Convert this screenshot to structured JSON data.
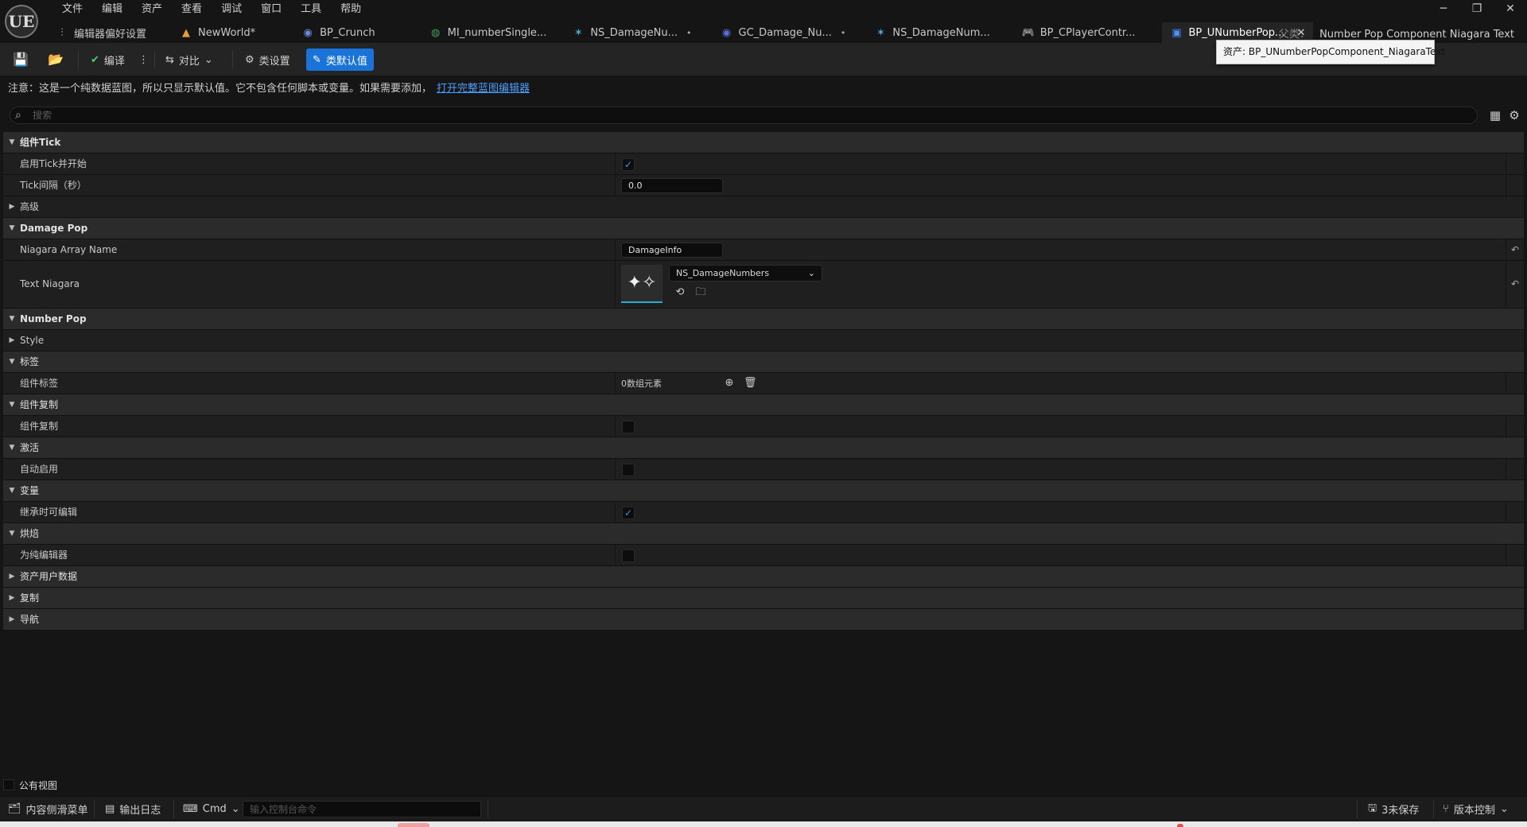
{
  "app": {
    "logo": "UE"
  },
  "menu": [
    "文件",
    "编辑",
    "资产",
    "查看",
    "调试",
    "窗口",
    "工具",
    "帮助"
  ],
  "window_controls": {
    "minimize": "─",
    "restore": "❐",
    "close": "✕"
  },
  "tabs": [
    {
      "label": "编辑器偏好设置",
      "icon": "sliders-icon",
      "glyph": "⫶",
      "dirty": false,
      "active": false
    },
    {
      "label": "NewWorld*",
      "icon": "level-icon",
      "glyph": "▲",
      "dirty": false,
      "active": false
    },
    {
      "label": "BP_Crunch",
      "icon": "character-icon",
      "glyph": "👤",
      "dirty": false,
      "active": false
    },
    {
      "label": "MI_numberSingle...",
      "icon": "material-instance-icon",
      "glyph": "◍",
      "dirty": false,
      "active": false
    },
    {
      "label": "NS_DamageNu...",
      "icon": "niagara-icon",
      "glyph": "✶",
      "dirty": true,
      "active": false
    },
    {
      "label": "GC_Damage_Nu...",
      "icon": "gameplay-cue-icon",
      "glyph": "◉",
      "dirty": true,
      "active": false
    },
    {
      "label": "NS_DamageNum...",
      "icon": "niagara-icon",
      "glyph": "✶",
      "dirty": false,
      "active": false
    },
    {
      "label": "BP_CPlayerContr...",
      "icon": "controller-icon",
      "glyph": "⌘",
      "dirty": false,
      "active": false
    },
    {
      "label": "BP_UNumberPop...",
      "icon": "blueprint-component-icon",
      "glyph": "▣",
      "dirty": false,
      "active": true
    }
  ],
  "parent_class": {
    "label": "父类：",
    "value": "Number Pop Component Niagara Text"
  },
  "tooltip": "资产: BP_UNumberPopComponent_NiagaraText",
  "toolbar": {
    "compile": "编译",
    "diff": "对比",
    "class_settings": "类设置",
    "class_defaults": "类默认值"
  },
  "notice": {
    "text": "注意：这是一个纯数据蓝图，所以只显示默认值。它不包含任何脚本或变量。如果需要添加，",
    "link": "打开完整蓝图编辑器"
  },
  "search": {
    "placeholder": "搜索"
  },
  "details": {
    "cat_tick": "组件Tick",
    "start_with_tick": "启用Tick并开始",
    "start_with_tick_value": true,
    "tick_interval": "Tick间隔（秒）",
    "tick_interval_value": "0.0",
    "advanced": "高级",
    "cat_damage_pop": "Damage Pop",
    "niagara_array_name": "Niagara Array Name",
    "niagara_array_name_value": "DamageInfo",
    "text_niagara": "Text Niagara",
    "text_niagara_value": "NS_DamageNumbers",
    "cat_number_pop": "Number Pop",
    "style": "Style",
    "cat_tags": "标签",
    "component_tags": "组件标签",
    "component_tags_value": "0数组元素",
    "cat_replication": "组件复制",
    "component_replicates": "组件复制",
    "component_replicates_value": false,
    "cat_activation": "激活",
    "auto_activate": "自动启用",
    "auto_activate_value": false,
    "cat_variable": "变量",
    "editable_when_inherited": "继承时可编辑",
    "editable_when_inherited_value": true,
    "cat_cooking": "烘焙",
    "editor_only": "为纯编辑器",
    "editor_only_value": false,
    "asset_user_data": "资产用户数据",
    "replication": "复制",
    "navigation": "导航"
  },
  "public_view": "公有视图",
  "statusbar": {
    "content_drawer": "内容侧滑菜单",
    "output_log": "输出日志",
    "cmd": "Cmd",
    "console_placeholder": "输入控制台命令",
    "unsaved": "3未保存",
    "source_control": "版本控制"
  },
  "colors": {
    "accent": "#1a73d8",
    "checkbox": "#3d8cff",
    "link": "#4aa0ff"
  }
}
